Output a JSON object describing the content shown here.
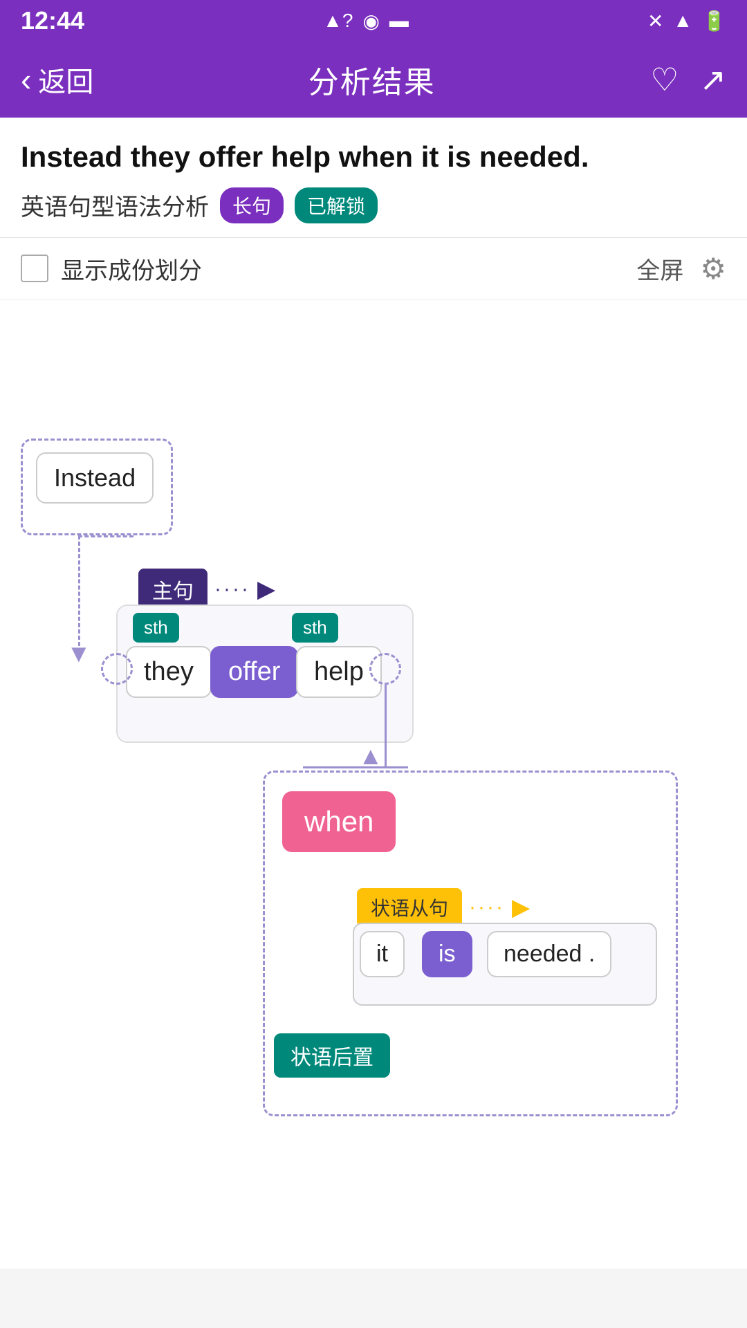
{
  "statusBar": {
    "time": "12:44",
    "leftIcons": [
      "signal-question",
      "radio",
      "sim"
    ],
    "rightIcons": [
      "wifi-x",
      "signal",
      "battery"
    ]
  },
  "header": {
    "backLabel": "返回",
    "title": "分析结果",
    "heartIcon": "♡",
    "shareIcon": "↗"
  },
  "sentence": {
    "english": "Instead they offer help when it is needed.",
    "chineseLabel": "英语句型语法分析",
    "badge1": "长句",
    "badge2": "已解锁"
  },
  "toolbar": {
    "checkboxLabel": "显示成份划分",
    "fullscreenLabel": "全屏",
    "settingsIcon": "⚙"
  },
  "diagram": {
    "instead": "Instead",
    "mainClauseLabel": "主句",
    "sth1": "sth",
    "sth2": "sth",
    "they": "they",
    "offer": "offer",
    "help": "help",
    "when": "when",
    "adverbClauseLabel": "状语从句",
    "it": "it",
    "is": "is",
    "needed": "needed .",
    "adverbPosLabel": "状语后置"
  }
}
